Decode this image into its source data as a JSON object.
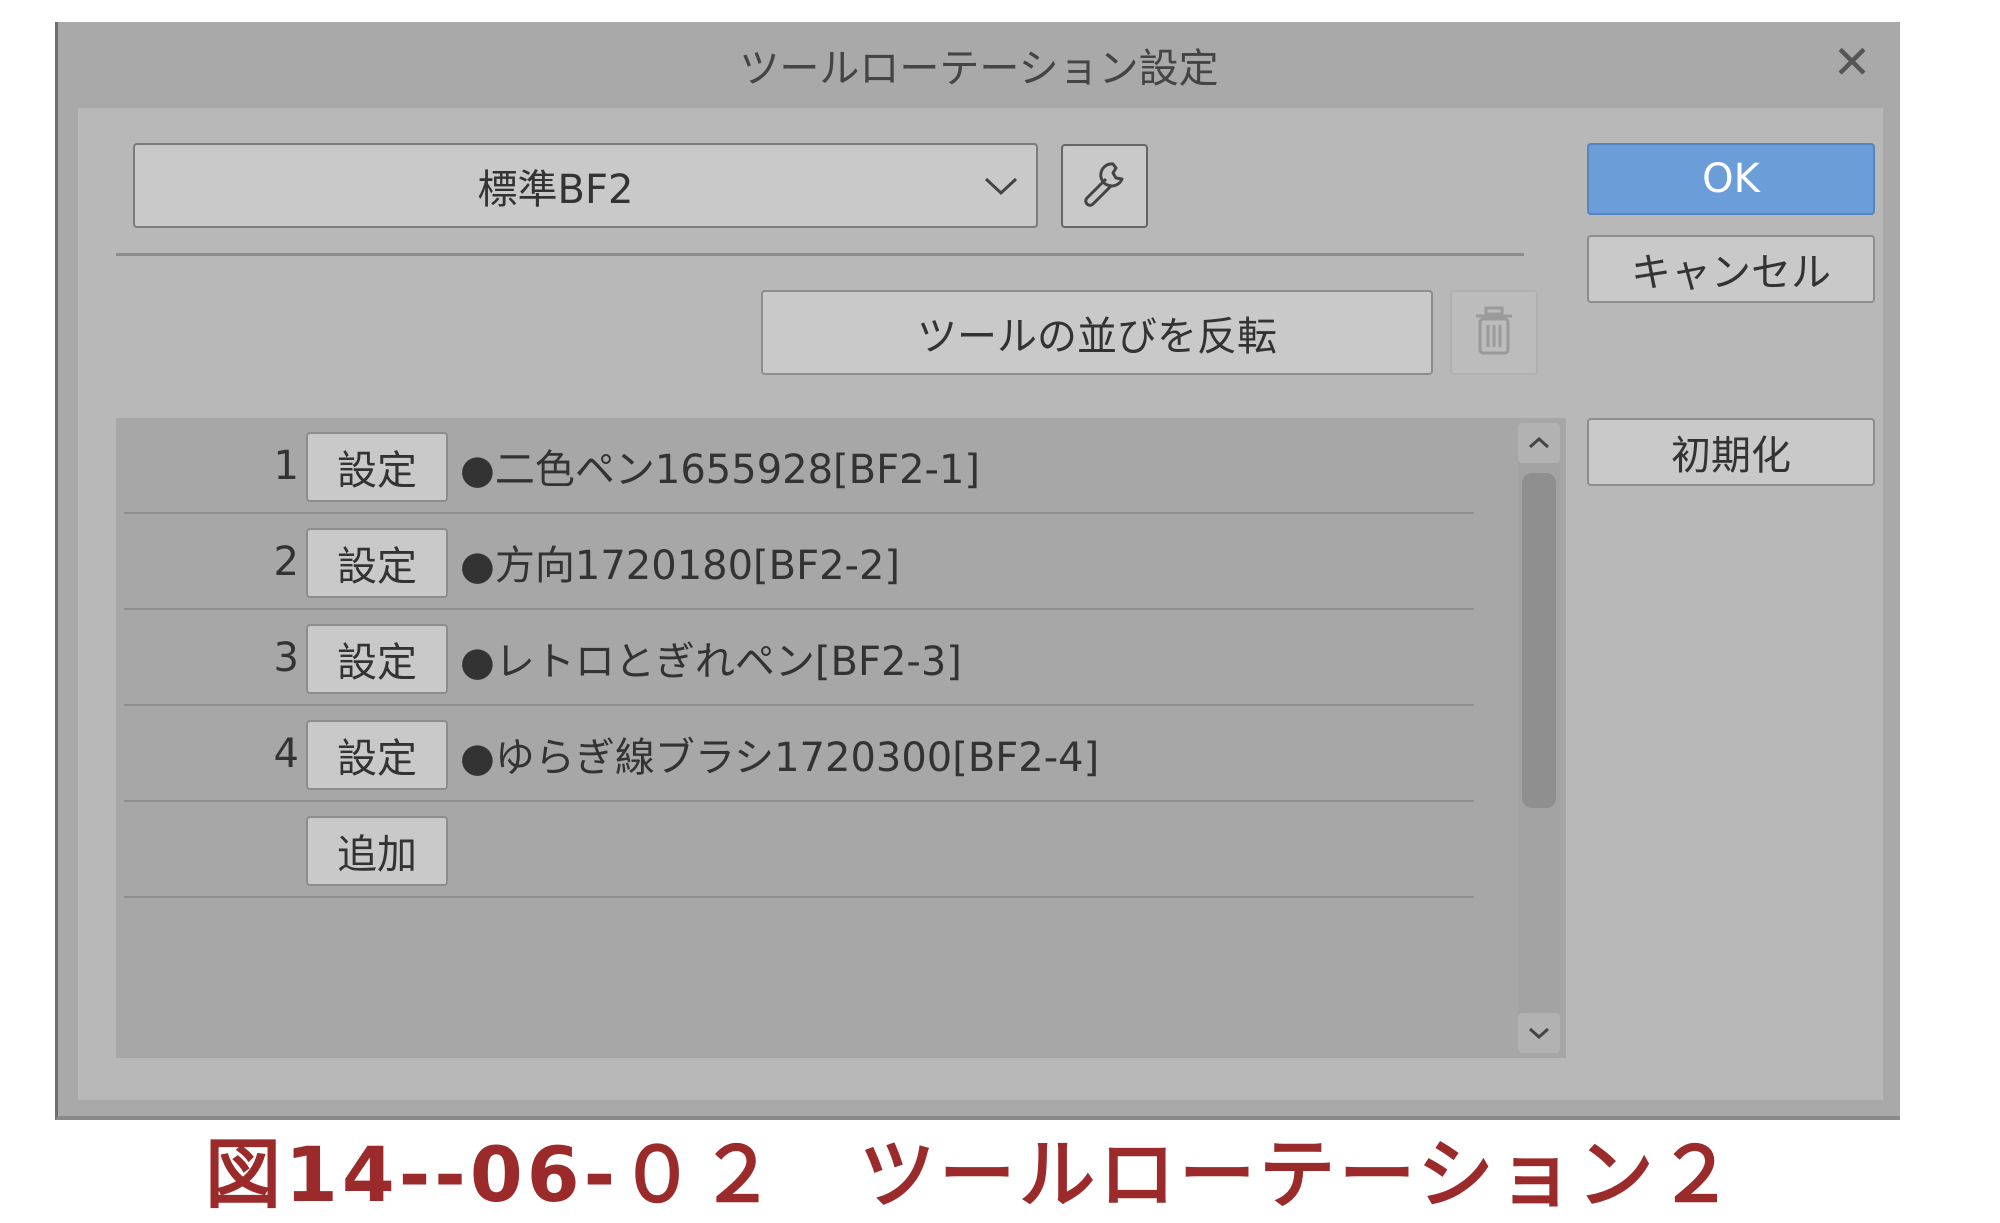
{
  "dialog": {
    "title": "ツールローテーション設定",
    "close_glyph": "✕",
    "preset": {
      "value": "標準BF2"
    },
    "reverse_label": "ツールの並びを反転",
    "ok_label": "OK",
    "cancel_label": "キャンセル",
    "reset_label": "初期化",
    "rows": [
      {
        "number": "1",
        "button": "設定",
        "name": "●二色ペン1655928[BF2-1]"
      },
      {
        "number": "2",
        "button": "設定",
        "name": "●方向1720180[BF2-2]"
      },
      {
        "number": "3",
        "button": "設定",
        "name": "●レトロとぎれペン[BF2-3]"
      },
      {
        "number": "4",
        "button": "設定",
        "name": "●ゆらぎ線ブラシ1720300[BF2-4]"
      }
    ],
    "add_label": "追加",
    "icons": {
      "settings": "wrench-icon",
      "delete": "trash-icon",
      "dropdown": "chevron-down-icon",
      "scroll_up": "chevron-up-icon",
      "scroll_down": "chevron-down-icon"
    }
  },
  "caption": "図14--06-０２　ツールローテーション２",
  "colors": {
    "ok_button": "#6b9ed8",
    "caption": "#9b2b2b",
    "dialog_background": "#b8b8b8"
  }
}
